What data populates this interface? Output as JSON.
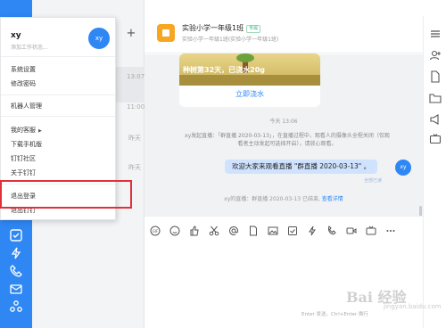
{
  "menu": {
    "user_name": "xy",
    "user_status_placeholder": "添加工作状态...",
    "avatar_text": "xy",
    "items": [
      {
        "label": "系统设置"
      },
      {
        "label": "修改密码"
      },
      {
        "label": "机器人管理"
      },
      {
        "label": "我的客服"
      },
      {
        "label": "下载手机版"
      },
      {
        "label": "钉钉社区"
      },
      {
        "label": "关于钉钉"
      },
      {
        "label": "退出登录"
      },
      {
        "label": "退出钉钉"
      }
    ]
  },
  "conversation_list": {
    "new_button": "+",
    "times": [
      "13:07",
      "11:00",
      "昨天",
      "昨天"
    ]
  },
  "chat": {
    "group_name": "实验小学一年级1班",
    "group_tag": "专属",
    "group_subtitle": "实验小学一年级1班(实验小学一年级1班)",
    "tree_card_text": "种树第32天，已浇水20g",
    "tree_card_link": "立即浇水",
    "time_separator": "今天 13:06",
    "live_notice": "xy发起直播：「群直播 2020-03-13」，在直播过程中，观看人的摄像头全程关闭（仅观看者主动发起可选择开启），请放心观看。",
    "outgoing_message": "欢迎大家来观看直播 \"群直播 2020-03-13\" 。",
    "outgoing_avatar": "xy",
    "read_status": "全部已读",
    "live_end_text": "xy的直播：群直播 2020-03-13 已结束,",
    "live_end_link": "查看详情"
  },
  "input": {
    "send_hint": "Enter 发送，Ctrl+Enter 换行"
  },
  "watermark": {
    "brand": "Bai 经验",
    "domain": "jingyan.baidu.com"
  },
  "colors": {
    "accent": "#2f87f4",
    "highlight": "#e0303a"
  }
}
